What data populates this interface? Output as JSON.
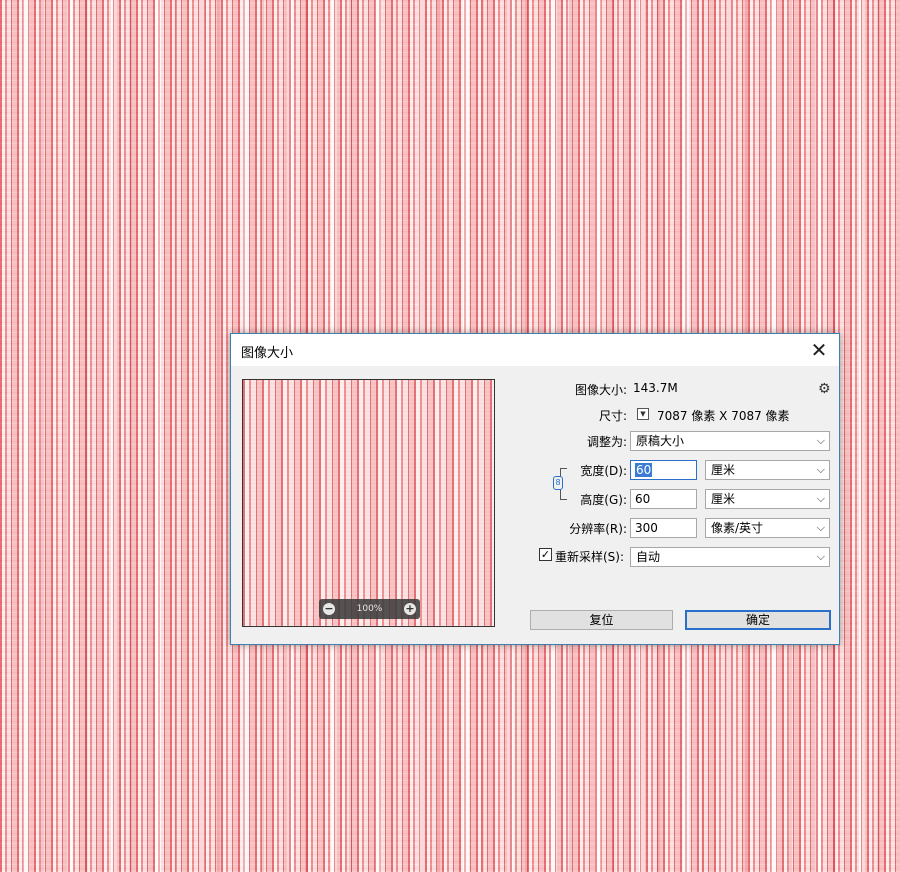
{
  "dialog": {
    "title": "图像大小",
    "close_glyph": "✕"
  },
  "preview": {
    "zoom_out_glyph": "−",
    "zoom_level": "100%",
    "zoom_in_glyph": "+"
  },
  "info": {
    "image_size_label": "图像大小:",
    "image_size_value": "143.7M",
    "gear_glyph": "⚙",
    "dimensions_label": "尺寸:",
    "dimensions_value": "7087 像素  X  7087 像素"
  },
  "fit_to": {
    "label": "调整为:",
    "value": "原稿大小"
  },
  "width": {
    "label": "宽度(D):",
    "value": "60",
    "unit": "厘米"
  },
  "height": {
    "label": "高度(G):",
    "value": "60",
    "unit": "厘米"
  },
  "resolution": {
    "label": "分辨率(R):",
    "value": "300",
    "unit": "像素/英寸"
  },
  "resample": {
    "label": "重新采样(S):",
    "checked": true,
    "check_glyph": "✓",
    "value": "自动"
  },
  "buttons": {
    "reset": "复位",
    "ok": "确定"
  },
  "icons": {
    "chevron": "⌵",
    "small_dropdown": "▼",
    "link": "8"
  },
  "colors": {
    "accent": "#2a6fc9",
    "dialog_bg": "#f0f0f0",
    "canvas_pink": "#f6b7b7",
    "canvas_red": "#d6323c"
  }
}
